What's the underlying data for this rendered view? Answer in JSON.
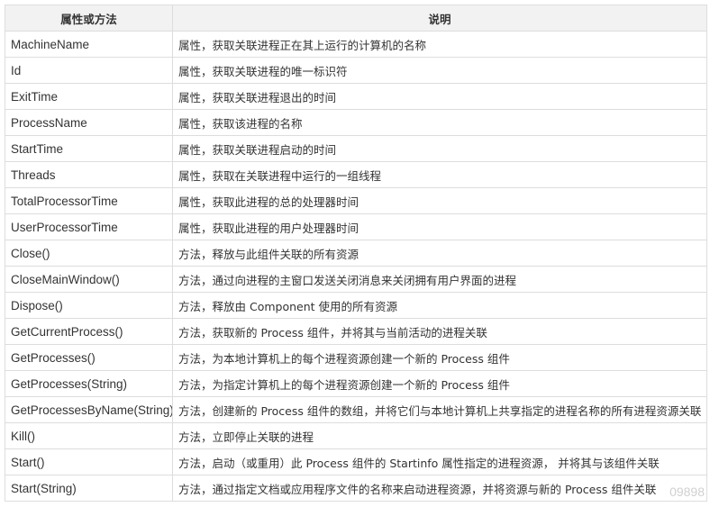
{
  "table": {
    "headers": [
      "属性或方法",
      "说明"
    ],
    "rows": [
      [
        "MachineName",
        "属性，获取关联进程正在其上运行的计算机的名称"
      ],
      [
        "Id",
        "属性，获取关联进程的唯一标识符"
      ],
      [
        "ExitTime",
        "属性，获取关联进程退出的时间"
      ],
      [
        "ProcessName",
        "属性，获取该进程的名称"
      ],
      [
        "StartTime",
        "属性，获取关联进程启动的时间"
      ],
      [
        "Threads",
        "属性，获取在关联进程中运行的一组线程"
      ],
      [
        "TotalProcessorTime",
        "属性，获取此进程的总的处理器时间"
      ],
      [
        "UserProcessorTime",
        "属性，获取此进程的用户处理器时间"
      ],
      [
        "Close()",
        "方法，释放与此组件关联的所有资源"
      ],
      [
        "CloseMainWindow()",
        "方法，通过向进程的主窗口发送关闭消息来关闭拥有用户界面的进程"
      ],
      [
        "Dispose()",
        "方法，释放由 Component 使用的所有资源"
      ],
      [
        "GetCurrentProcess()",
        "方法，获取新的 Process 组件，并将其与当前活动的进程关联"
      ],
      [
        "GetProcesses()",
        "方法，为本地计算机上的每个进程资源创建一个新的 Process 组件"
      ],
      [
        "GetProcesses(String)",
        "方法，为指定计算机上的每个进程资源创建一个新的 Process 组件"
      ],
      [
        "GetProcessesByName(String)",
        "方法，创建新的 Process 组件的数组，并将它们与本地计算机上共享指定的进程名称的所有进程资源关联"
      ],
      [
        "Kill()",
        "方法，立即停止关联的进程"
      ],
      [
        "Start()",
        "方法，启动（或重用）此 Process 组件的 Startinfo 属性指定的进程资源， 并将其与该组件关联"
      ],
      [
        "Start(String)",
        "方法，通过指定文档或应用程序文件的名称来启动进程资源，并将资源与新的 Process 组件关联"
      ]
    ]
  },
  "watermark": "09898"
}
